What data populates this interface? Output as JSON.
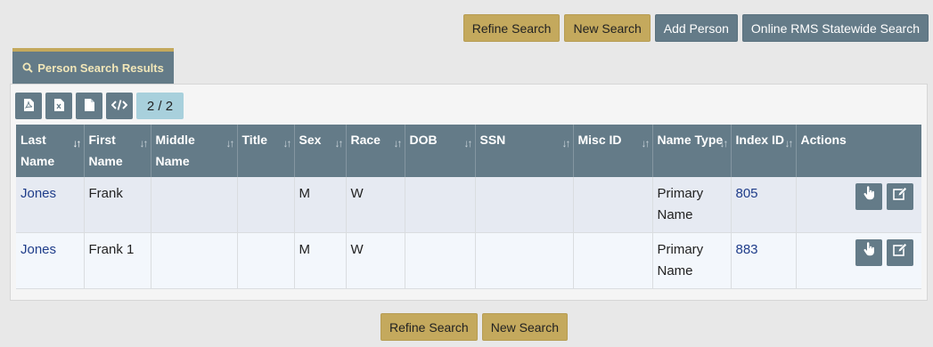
{
  "top_actions": {
    "refine": "Refine Search",
    "new": "New Search",
    "add_person": "Add Person",
    "statewide": "Online RMS Statewide Search"
  },
  "tab": {
    "label": "Person Search Results",
    "icon": "search-icon"
  },
  "toolbar": {
    "icons": [
      "pdf-file-icon",
      "excel-file-icon",
      "document-icon",
      "code-icon"
    ],
    "page_indicator": "2 / 2"
  },
  "table": {
    "headers": [
      "Last Name",
      "First Name",
      "Middle Name",
      "Title",
      "Sex",
      "Race",
      "DOB",
      "SSN",
      "Misc ID",
      "Name Type",
      "Index ID",
      "Actions"
    ],
    "rows": [
      {
        "last": "Jones",
        "first": "Frank",
        "middle": "",
        "title": "",
        "sex": "M",
        "race": "W",
        "dob": "",
        "ssn": "",
        "misc": "",
        "type": "Primary Name",
        "index": "805"
      },
      {
        "last": "Jones",
        "first": "Frank 1",
        "middle": "",
        "title": "",
        "sex": "M",
        "race": "W",
        "dob": "",
        "ssn": "",
        "misc": "",
        "type": "Primary Name",
        "index": "883"
      }
    ]
  },
  "bottom_actions": {
    "refine": "Refine Search",
    "new": "New Search"
  },
  "colors": {
    "gold": "#c4a95d",
    "slate": "#647b88",
    "link": "#1f3d8a",
    "page_indicator": "#a8d0dc"
  }
}
